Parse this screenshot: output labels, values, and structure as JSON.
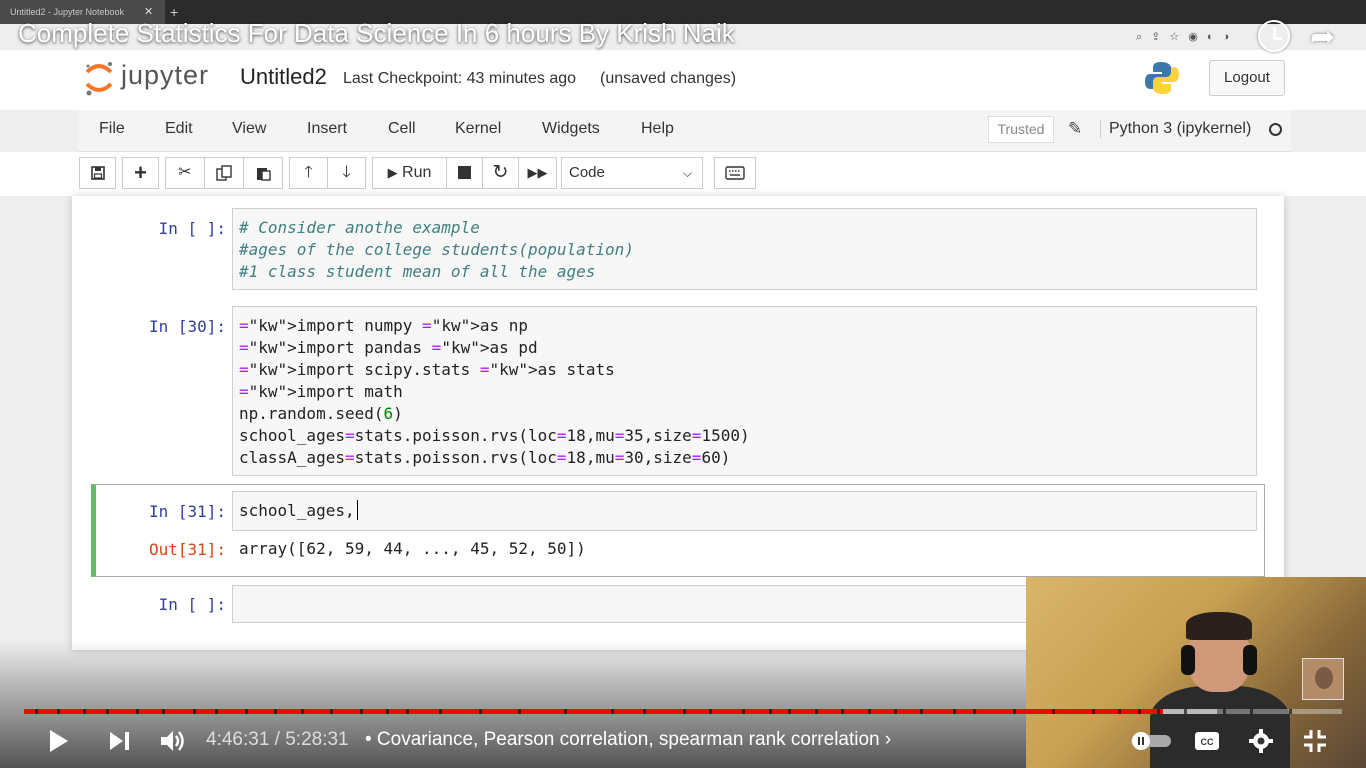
{
  "browser": {
    "tab_title": "Untitled2 - Jupyter Notebook",
    "tab_close": "✕",
    "new_tab": "+"
  },
  "video": {
    "title": "Complete Statistics For Data Science In 6 hours By Krish Naik",
    "time_display": "4:46:31 / 5:28:31",
    "chapter": "• Covariance, Pearson correlation, spearman rank correlation ›",
    "progress_fraction": 0.864,
    "buffer_fraction": 0.905
  },
  "jupyter": {
    "logo_text": "jupyter",
    "notebook_name": "Untitled2",
    "checkpoint": "Last Checkpoint: 43 minutes ago",
    "unsaved": "(unsaved changes)",
    "logout": "Logout",
    "menu": [
      "File",
      "Edit",
      "View",
      "Insert",
      "Cell",
      "Kernel",
      "Widgets",
      "Help"
    ],
    "trusted": "Trusted",
    "kernel": "Python 3 (ipykernel)",
    "toolbar": {
      "run": "Run",
      "cell_type": "Code"
    }
  },
  "cells": [
    {
      "prompt": "In [ ]:",
      "lines": [
        "# Consider anothe example",
        "#ages of the college students(population)",
        "#1 class student mean of all the ages"
      ]
    },
    {
      "prompt": "In [30]:",
      "lines": [
        "import numpy as np",
        "import pandas as pd",
        "import scipy.stats as stats",
        "import math",
        "np.random.seed(6)",
        "school_ages=stats.poisson.rvs(loc=18,mu=35,size=1500)",
        "classA_ages=stats.poisson.rvs(loc=18,mu=30,size=60)"
      ]
    },
    {
      "prompt": "In [31]:",
      "input": "school_ages,",
      "out_prompt": "Out[31]:",
      "output": "array([62, 59, 44, ..., 45, 52, 50])"
    },
    {
      "prompt": "In [ ]:",
      "input": ""
    }
  ]
}
